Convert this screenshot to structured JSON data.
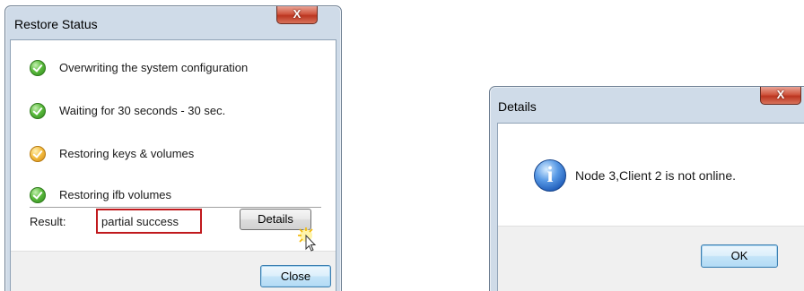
{
  "restore_dialog": {
    "title": "Restore Status",
    "close_glyph": "X",
    "steps": [
      {
        "label": "Overwriting the system configuration",
        "status": "done",
        "icon": "check-circle-icon"
      },
      {
        "label": "Waiting for 30 seconds - 30 sec.",
        "status": "done",
        "icon": "check-circle-icon"
      },
      {
        "label": "Restoring keys & volumes",
        "status": "warning",
        "icon": "warning-check-circle-icon"
      },
      {
        "label": "Restoring ifb volumes",
        "status": "done",
        "icon": "check-circle-icon"
      }
    ],
    "result_label": "Result:",
    "result_value": "partial success",
    "details_button": "Details",
    "close_button": "Close"
  },
  "details_dialog": {
    "title": "Details",
    "close_glyph": "X",
    "icon": "info-icon",
    "info_glyph": "i",
    "message": "Node 3,Client 2 is not online.",
    "ok_button": "OK"
  },
  "colors": {
    "highlight_border": "#c0191d",
    "check_green": "#5cbc3e",
    "check_orange": "#f5c044",
    "info_blue": "#1d5bb8"
  }
}
